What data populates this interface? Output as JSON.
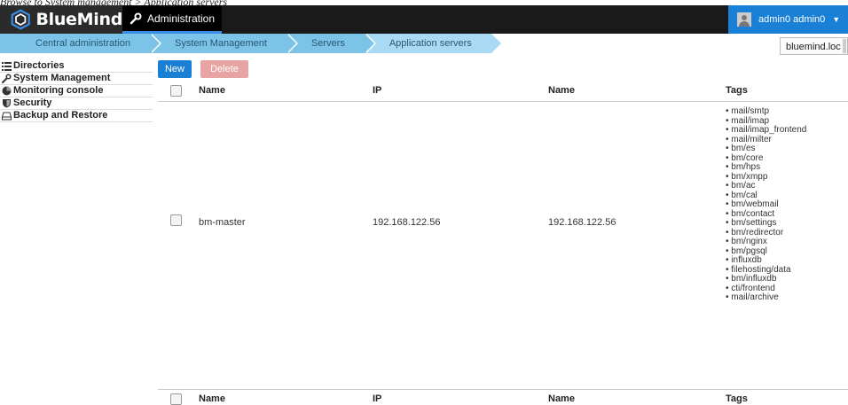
{
  "caption": "Browse to System management > Application servers",
  "topbar": {
    "logo_text": "BlueMind",
    "app_menu_label": "Administration",
    "user_label": "admin0 admin0"
  },
  "breadcrumb": [
    "Central administration",
    "System Management",
    "Servers",
    "Application servers"
  ],
  "domain_select": {
    "value": "bluemind.loc"
  },
  "sidebar": {
    "items": [
      {
        "label": "Directories",
        "icon": "list-icon"
      },
      {
        "label": "System Management",
        "icon": "wrench-icon"
      },
      {
        "label": "Monitoring console",
        "icon": "chart-icon"
      },
      {
        "label": "Security",
        "icon": "shield-icon"
      },
      {
        "label": "Backup and Restore",
        "icon": "drive-icon"
      }
    ]
  },
  "toolbar": {
    "new_label": "New",
    "delete_label": "Delete"
  },
  "table": {
    "columns": [
      "Name",
      "IP",
      "Name",
      "Tags"
    ],
    "rows": [
      {
        "name": "bm-master",
        "ip": "192.168.122.56",
        "name2": "192.168.122.56",
        "tags": [
          "mail/smtp",
          "mail/imap",
          "mail/imap_frontend",
          "mail/milter",
          "bm/es",
          "bm/core",
          "bm/hps",
          "bm/xmpp",
          "bm/ac",
          "bm/cal",
          "bm/webmail",
          "bm/contact",
          "bm/settings",
          "bm/redirector",
          "bm/nginx",
          "bm/pgsql",
          "influxdb",
          "filehosting/data",
          "bm/influxdb",
          "cti/frontend",
          "mail/archive"
        ]
      }
    ]
  },
  "colors": {
    "accent": "#1a80d6",
    "breadcrumb": "#7cc3e8",
    "delete": "#e8a3a3"
  }
}
